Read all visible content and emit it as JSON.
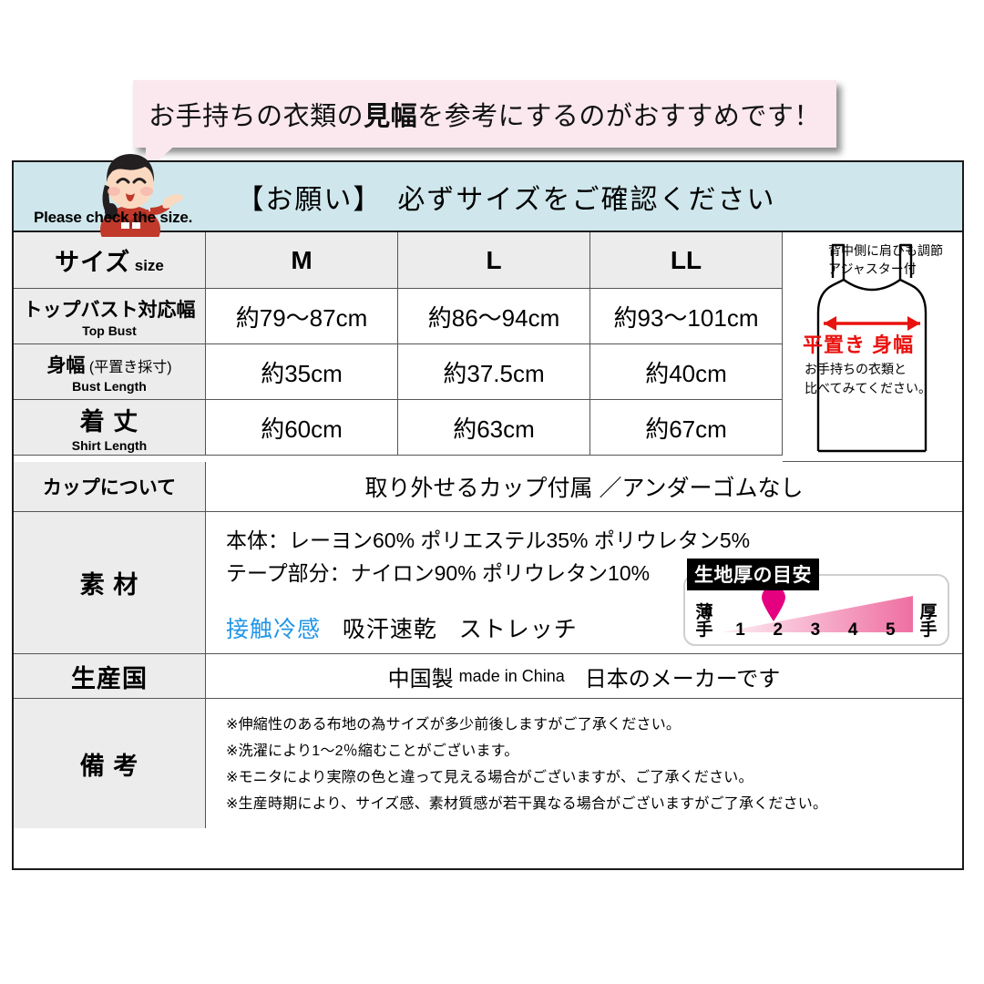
{
  "bubble": {
    "text_before": "お手持ちの衣類の",
    "text_bold": "見幅",
    "text_after": "を参考にするのがおすすめです！"
  },
  "banner": {
    "title": "【お願い】　必ずサイズをご確認ください",
    "english": "Please check the size.",
    "bg_color": "#cfe7ec"
  },
  "size_table": {
    "header": {
      "label_jp": "サイズ",
      "label_en": "size",
      "columns": [
        "M",
        "L",
        "LL"
      ]
    },
    "rows": [
      {
        "label_jp": "トップバスト対応幅",
        "label_en": "Top Bust",
        "values": [
          "約79〜87cm",
          "約86〜94cm",
          "約93〜101cm"
        ]
      },
      {
        "label_jp": "身幅",
        "label_paren": "(平置き採寸)",
        "label_en": "Bust Length",
        "values": [
          "約35cm",
          "約37.5cm",
          "約40cm"
        ]
      },
      {
        "label_jp": "着 丈",
        "label_en": "Shirt Length",
        "values": [
          "約60cm",
          "約63cm",
          "約67cm"
        ]
      }
    ]
  },
  "diagram": {
    "top_note_line1": "背中側に肩ひも調節",
    "top_note_line2": "アジャスター付",
    "arrow_label": "平置き 身幅",
    "arrow_color": "#e8120e",
    "bottom_note_line1": "お手持ちの衣類と",
    "bottom_note_line2": "比べてみてください。"
  },
  "cup": {
    "label": "カップについて",
    "value": "取り外せるカップ付属 ／アンダーゴムなし"
  },
  "material": {
    "label": "素 材",
    "line1": "本体：レーヨン60% ポリエステル35% ポリウレタン5%",
    "line2": "テープ部分：ナイロン90% ポリウレタン10%",
    "feature_cool": "接触冷感",
    "feature_2": "吸汗速乾",
    "feature_3": "ストレッチ",
    "cool_color": "#2196e8"
  },
  "gauge": {
    "title": "生地厚の目安",
    "thin_label_l1": "薄",
    "thin_label_l2": "手",
    "thick_label_l1": "厚",
    "thick_label_l2": "手",
    "scale": [
      "1",
      "2",
      "3",
      "4",
      "5"
    ],
    "selected": 2,
    "marker_color": "#e5007f"
  },
  "origin": {
    "label": "生産国",
    "value_jp": "中国製",
    "value_en": "made in China",
    "value_maker": "日本のメーカーです"
  },
  "notes": {
    "label": "備 考",
    "lines": [
      "※伸縮性のある布地の為サイズが多少前後しますがご了承ください。",
      "※洗濯により1〜2％縮むことがございます。",
      "※モニタにより実際の色と違って見える場合がございますが、ご了承ください。",
      "※生産時期により、サイズ感、素材質感が若干異なる場合がございますがご了承ください。"
    ]
  }
}
